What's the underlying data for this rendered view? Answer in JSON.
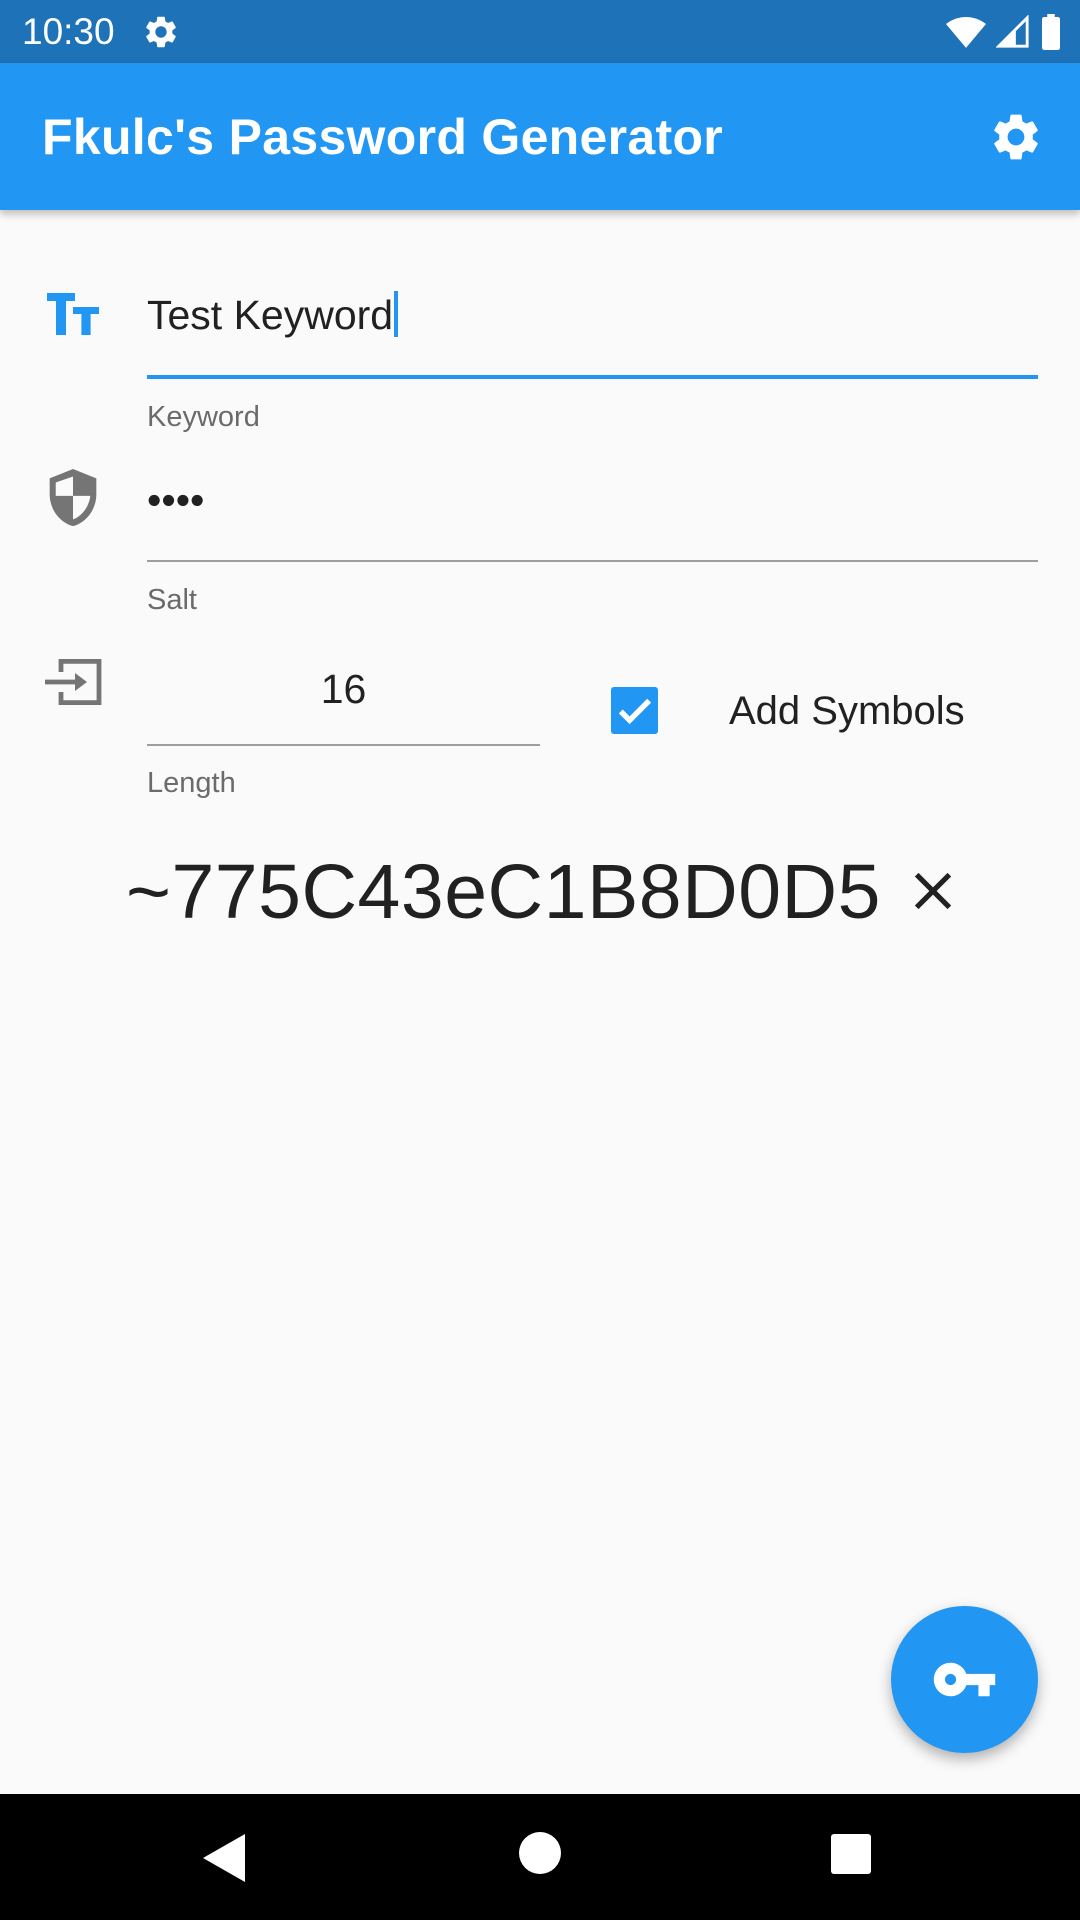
{
  "status_bar": {
    "time": "10:30",
    "icons": [
      "gear-icon",
      "wifi-icon",
      "signal-icon",
      "battery-icon"
    ]
  },
  "app_bar": {
    "title": "Fkulc's Password Generator",
    "settings_icon": "gear-icon"
  },
  "form": {
    "keyword": {
      "value": "Test Keyword",
      "label": "Keyword",
      "icon": "text-size-icon",
      "focused": true
    },
    "salt": {
      "value": "••••",
      "label": "Salt",
      "icon": "shield-icon"
    },
    "length": {
      "value": "16",
      "label": "Length",
      "icon": "input-icon"
    },
    "add_symbols": {
      "label": "Add Symbols",
      "checked": true
    }
  },
  "result": {
    "password": "~775C43eC1B8D0D5",
    "clear_icon": "close-icon"
  },
  "fab": {
    "icon": "key-icon"
  },
  "nav_bar": {
    "buttons": [
      "back-icon",
      "home-icon",
      "recents-icon"
    ]
  },
  "colors": {
    "primary": "#2196f3",
    "status_bar": "#1e72b8",
    "background": "#fafafa",
    "text": "#212121",
    "label": "#6b6b6b",
    "icon_grey": "#757575"
  }
}
